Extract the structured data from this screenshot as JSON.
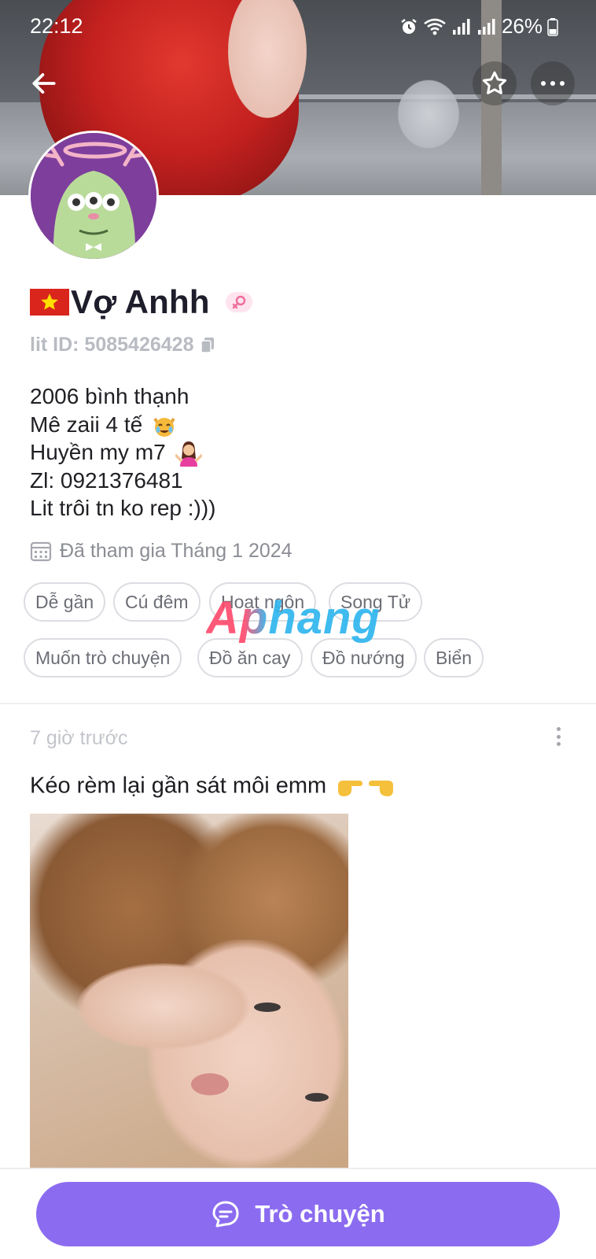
{
  "status_bar": {
    "time": "22:12",
    "battery": "26%",
    "icons": [
      "alarm-icon",
      "wifi-icon",
      "signal-icon",
      "signal-icon",
      "battery-icon"
    ]
  },
  "header": {
    "back_icon": "arrow-left-icon",
    "favorite_icon": "star-icon",
    "more_icon": "more-horizontal-icon"
  },
  "profile": {
    "flag": "vietnam-flag-icon",
    "name": "Vợ Anhh",
    "gender_icon": "female-gender-icon",
    "lit_id": "lit ID: 5085426428",
    "bio": [
      {
        "text": "2006 bình thạnh",
        "emoji": ""
      },
      {
        "text": "Mê zaii 4 tế",
        "emoji": "crying-cat-emoji"
      },
      {
        "text": "Huyền my m7",
        "emoji": "shrugging-woman-emoji"
      },
      {
        "text": "Zl: 0921376481",
        "emoji": ""
      },
      {
        "text": "Lit trôi tn ko rep :)))",
        "emoji": ""
      }
    ],
    "joined": "Đã tham gia Tháng 1 2024",
    "tags": [
      "Dễ gần",
      "Cú đêm",
      "Hoạt ngôn",
      "Song Tử",
      "Muốn trò chuyện",
      "Đồ ăn cay",
      "Đồ nướng",
      "Biển"
    ]
  },
  "watermark": "Aphang",
  "post": {
    "time": "7 giờ trước",
    "text": "Kéo rèm lại gần sát môi emm",
    "text_emoji": "pointing-hands-emoji"
  },
  "footer": {
    "chat_label": "Trò chuyện"
  },
  "colors": {
    "accent": "#8b6cf0",
    "tag_border": "#dcdde2",
    "muted_text": "#8b8d94"
  }
}
